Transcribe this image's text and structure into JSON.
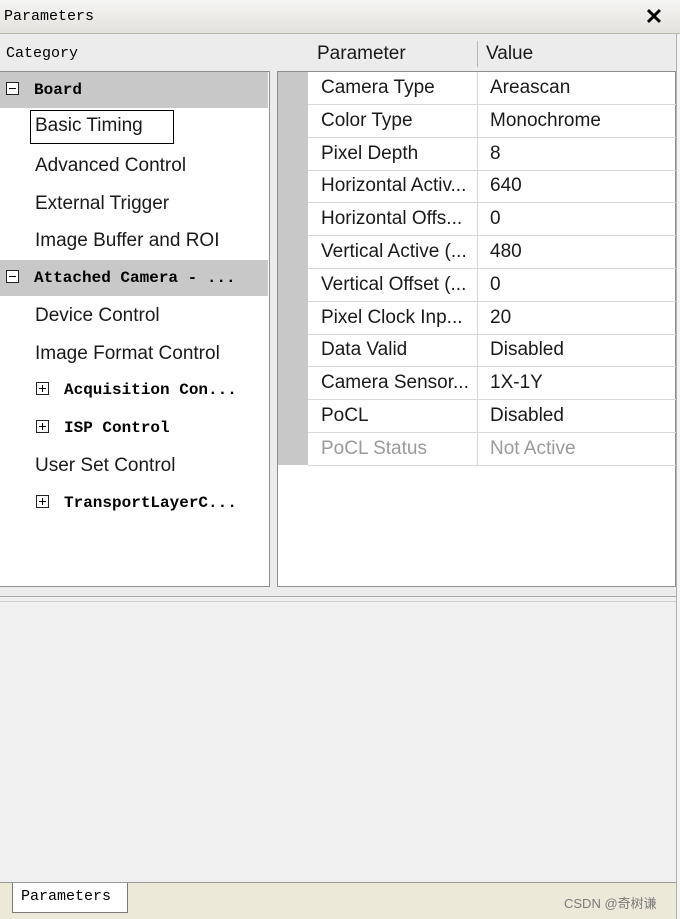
{
  "window": {
    "title": "Parameters",
    "close_icon": "close-icon"
  },
  "category": {
    "header": "Category",
    "items": [
      {
        "label": "Board",
        "type": "group",
        "expanded": true
      },
      {
        "label": "Basic Timing",
        "type": "item",
        "selected": true
      },
      {
        "label": "Advanced Control",
        "type": "item"
      },
      {
        "label": "External Trigger",
        "type": "item"
      },
      {
        "label": "Image Buffer and ROI",
        "type": "item"
      },
      {
        "label": "Attached Camera - ...",
        "type": "group",
        "expanded": true
      },
      {
        "label": "Device Control",
        "type": "item"
      },
      {
        "label": "Image Format Control",
        "type": "item"
      },
      {
        "label": "Acquisition Con...",
        "type": "group",
        "expanded": false
      },
      {
        "label": "ISP Control",
        "type": "group",
        "expanded": false
      },
      {
        "label": "User Set Control",
        "type": "item"
      },
      {
        "label": "TransportLayerC...",
        "type": "group",
        "expanded": false
      }
    ]
  },
  "params": {
    "col_parameter": "Parameter",
    "col_value": "Value",
    "rows": [
      {
        "name": "Camera Type",
        "value": "Areascan"
      },
      {
        "name": "Color Type",
        "value": "Monochrome"
      },
      {
        "name": "Pixel Depth",
        "value": "8"
      },
      {
        "name": "Horizontal Activ...",
        "value": "640"
      },
      {
        "name": "Horizontal Offs...",
        "value": "0"
      },
      {
        "name": "Vertical Active (...",
        "value": "480"
      },
      {
        "name": "Vertical Offset (...",
        "value": "0"
      },
      {
        "name": "Pixel Clock Inp...",
        "value": "20"
      },
      {
        "name": "Data Valid",
        "value": "Disabled"
      },
      {
        "name": "Camera Sensor...",
        "value": "1X-1Y"
      },
      {
        "name": "PoCL",
        "value": "Disabled"
      },
      {
        "name": "PoCL Status",
        "value": "Not Active",
        "disabled": true
      }
    ]
  },
  "bottom_tab": {
    "label": "Parameters"
  },
  "watermark": "CSDN @奇树谦"
}
